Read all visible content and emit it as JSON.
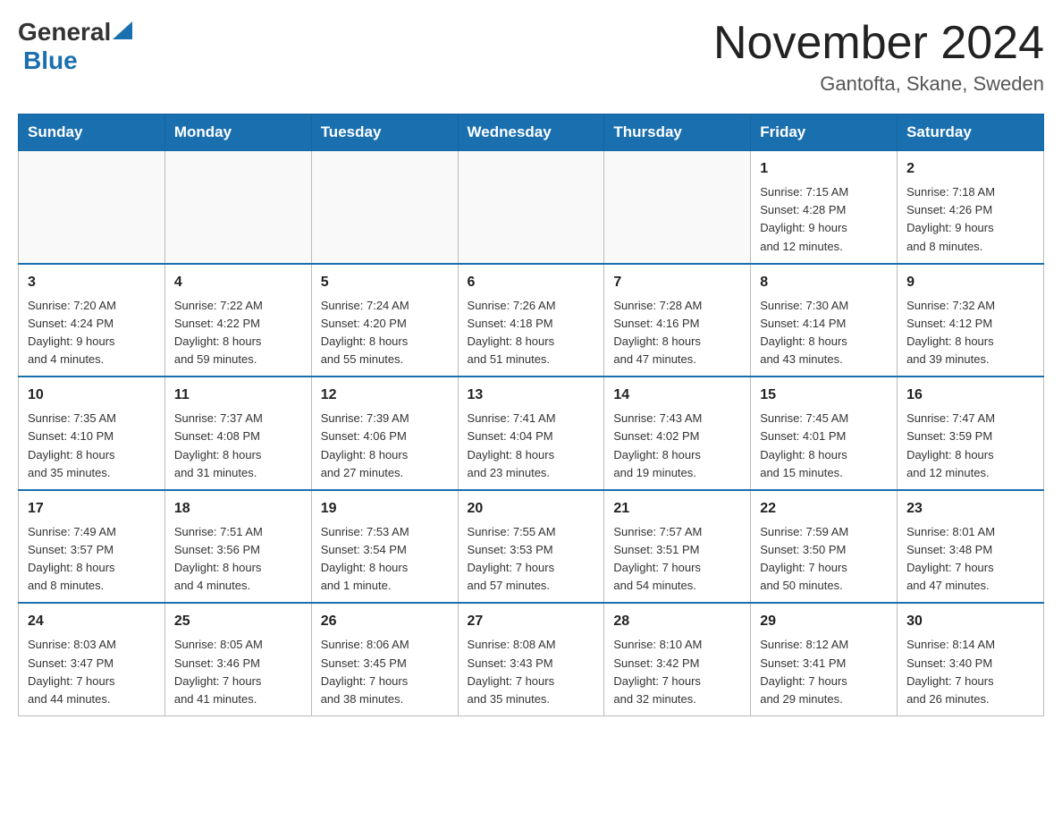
{
  "header": {
    "logo_general": "General",
    "logo_blue": "Blue",
    "month_title": "November 2024",
    "location": "Gantofta, Skane, Sweden"
  },
  "weekdays": [
    "Sunday",
    "Monday",
    "Tuesday",
    "Wednesday",
    "Thursday",
    "Friday",
    "Saturday"
  ],
  "weeks": [
    {
      "days": [
        {
          "number": "",
          "info": ""
        },
        {
          "number": "",
          "info": ""
        },
        {
          "number": "",
          "info": ""
        },
        {
          "number": "",
          "info": ""
        },
        {
          "number": "",
          "info": ""
        },
        {
          "number": "1",
          "info": "Sunrise: 7:15 AM\nSunset: 4:28 PM\nDaylight: 9 hours\nand 12 minutes."
        },
        {
          "number": "2",
          "info": "Sunrise: 7:18 AM\nSunset: 4:26 PM\nDaylight: 9 hours\nand 8 minutes."
        }
      ]
    },
    {
      "days": [
        {
          "number": "3",
          "info": "Sunrise: 7:20 AM\nSunset: 4:24 PM\nDaylight: 9 hours\nand 4 minutes."
        },
        {
          "number": "4",
          "info": "Sunrise: 7:22 AM\nSunset: 4:22 PM\nDaylight: 8 hours\nand 59 minutes."
        },
        {
          "number": "5",
          "info": "Sunrise: 7:24 AM\nSunset: 4:20 PM\nDaylight: 8 hours\nand 55 minutes."
        },
        {
          "number": "6",
          "info": "Sunrise: 7:26 AM\nSunset: 4:18 PM\nDaylight: 8 hours\nand 51 minutes."
        },
        {
          "number": "7",
          "info": "Sunrise: 7:28 AM\nSunset: 4:16 PM\nDaylight: 8 hours\nand 47 minutes."
        },
        {
          "number": "8",
          "info": "Sunrise: 7:30 AM\nSunset: 4:14 PM\nDaylight: 8 hours\nand 43 minutes."
        },
        {
          "number": "9",
          "info": "Sunrise: 7:32 AM\nSunset: 4:12 PM\nDaylight: 8 hours\nand 39 minutes."
        }
      ]
    },
    {
      "days": [
        {
          "number": "10",
          "info": "Sunrise: 7:35 AM\nSunset: 4:10 PM\nDaylight: 8 hours\nand 35 minutes."
        },
        {
          "number": "11",
          "info": "Sunrise: 7:37 AM\nSunset: 4:08 PM\nDaylight: 8 hours\nand 31 minutes."
        },
        {
          "number": "12",
          "info": "Sunrise: 7:39 AM\nSunset: 4:06 PM\nDaylight: 8 hours\nand 27 minutes."
        },
        {
          "number": "13",
          "info": "Sunrise: 7:41 AM\nSunset: 4:04 PM\nDaylight: 8 hours\nand 23 minutes."
        },
        {
          "number": "14",
          "info": "Sunrise: 7:43 AM\nSunset: 4:02 PM\nDaylight: 8 hours\nand 19 minutes."
        },
        {
          "number": "15",
          "info": "Sunrise: 7:45 AM\nSunset: 4:01 PM\nDaylight: 8 hours\nand 15 minutes."
        },
        {
          "number": "16",
          "info": "Sunrise: 7:47 AM\nSunset: 3:59 PM\nDaylight: 8 hours\nand 12 minutes."
        }
      ]
    },
    {
      "days": [
        {
          "number": "17",
          "info": "Sunrise: 7:49 AM\nSunset: 3:57 PM\nDaylight: 8 hours\nand 8 minutes."
        },
        {
          "number": "18",
          "info": "Sunrise: 7:51 AM\nSunset: 3:56 PM\nDaylight: 8 hours\nand 4 minutes."
        },
        {
          "number": "19",
          "info": "Sunrise: 7:53 AM\nSunset: 3:54 PM\nDaylight: 8 hours\nand 1 minute."
        },
        {
          "number": "20",
          "info": "Sunrise: 7:55 AM\nSunset: 3:53 PM\nDaylight: 7 hours\nand 57 minutes."
        },
        {
          "number": "21",
          "info": "Sunrise: 7:57 AM\nSunset: 3:51 PM\nDaylight: 7 hours\nand 54 minutes."
        },
        {
          "number": "22",
          "info": "Sunrise: 7:59 AM\nSunset: 3:50 PM\nDaylight: 7 hours\nand 50 minutes."
        },
        {
          "number": "23",
          "info": "Sunrise: 8:01 AM\nSunset: 3:48 PM\nDaylight: 7 hours\nand 47 minutes."
        }
      ]
    },
    {
      "days": [
        {
          "number": "24",
          "info": "Sunrise: 8:03 AM\nSunset: 3:47 PM\nDaylight: 7 hours\nand 44 minutes."
        },
        {
          "number": "25",
          "info": "Sunrise: 8:05 AM\nSunset: 3:46 PM\nDaylight: 7 hours\nand 41 minutes."
        },
        {
          "number": "26",
          "info": "Sunrise: 8:06 AM\nSunset: 3:45 PM\nDaylight: 7 hours\nand 38 minutes."
        },
        {
          "number": "27",
          "info": "Sunrise: 8:08 AM\nSunset: 3:43 PM\nDaylight: 7 hours\nand 35 minutes."
        },
        {
          "number": "28",
          "info": "Sunrise: 8:10 AM\nSunset: 3:42 PM\nDaylight: 7 hours\nand 32 minutes."
        },
        {
          "number": "29",
          "info": "Sunrise: 8:12 AM\nSunset: 3:41 PM\nDaylight: 7 hours\nand 29 minutes."
        },
        {
          "number": "30",
          "info": "Sunrise: 8:14 AM\nSunset: 3:40 PM\nDaylight: 7 hours\nand 26 minutes."
        }
      ]
    }
  ]
}
